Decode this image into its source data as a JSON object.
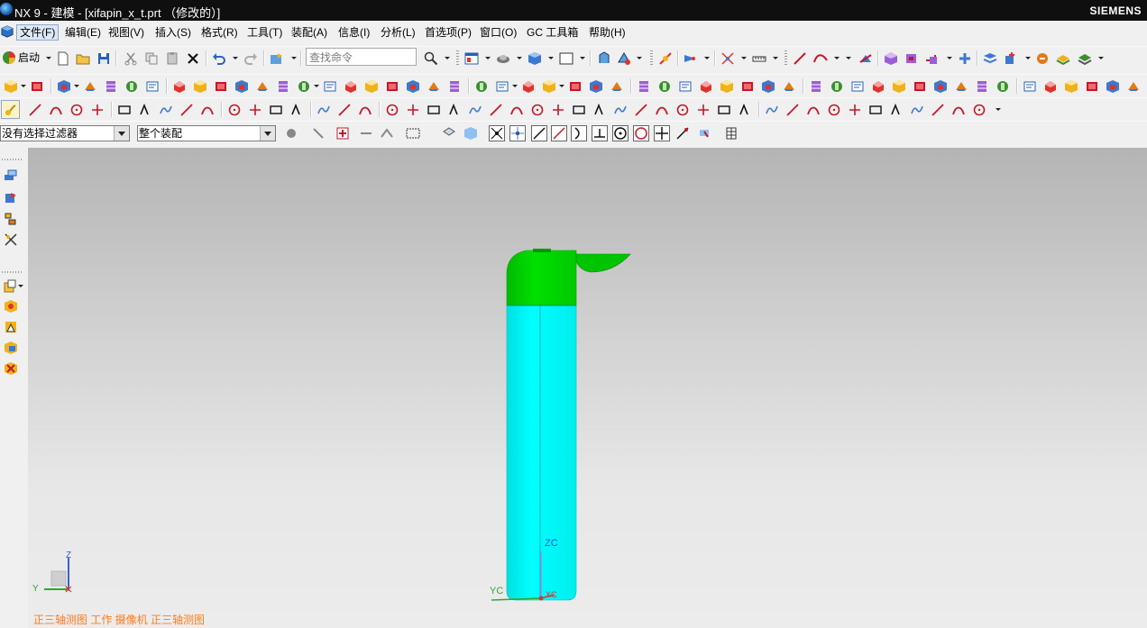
{
  "window": {
    "title": "NX 9 - 建模 - [xifapin_x_t.prt （修改的）]",
    "brand": "SIEMENS"
  },
  "menubar": {
    "items": [
      {
        "label": "文件(F)",
        "active": true
      },
      {
        "label": "编辑(E)"
      },
      {
        "label": "视图(V)"
      },
      {
        "label": "插入(S)"
      },
      {
        "label": "格式(R)"
      },
      {
        "label": "工具(T)"
      },
      {
        "label": "装配(A)"
      },
      {
        "label": "信息(I)"
      },
      {
        "label": "分析(L)"
      },
      {
        "label": "首选项(P)"
      },
      {
        "label": "窗口(O)"
      },
      {
        "label": "GC 工具箱"
      },
      {
        "label": "帮助(H)"
      }
    ]
  },
  "standard_toolbar": {
    "start_label": "启动",
    "search_placeholder": "查找命令"
  },
  "selection_bar": {
    "filter_value": "没有选择过滤器",
    "scope_value": "整个装配"
  },
  "graphics": {
    "view_label": "正三轴测图 工作 摄像机 正三轴测图",
    "wcs_labels": {
      "z": "ZC",
      "y": "YC",
      "x": "XC"
    },
    "triad_labels": {
      "z": "Z",
      "y": "Y",
      "x": "X"
    }
  },
  "colors": {
    "part_body": "#00ffff",
    "part_cap": "#00d400",
    "view_label": "#ff7a1a",
    "resource_border": "#f29a3d"
  }
}
